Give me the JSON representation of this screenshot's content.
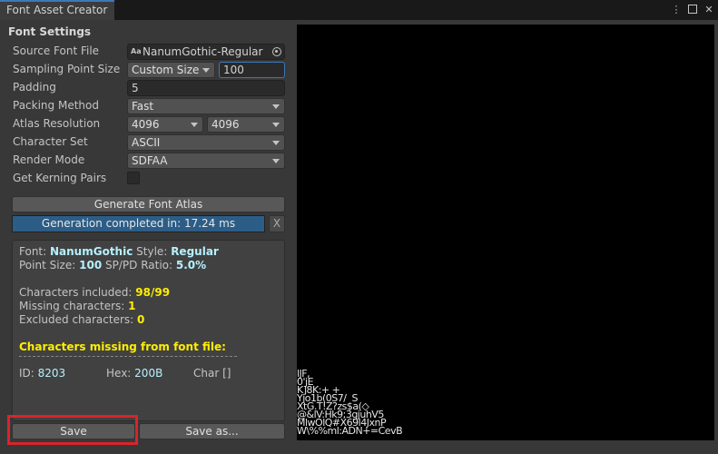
{
  "window": {
    "tab_title": "Font Asset Creator",
    "menu_icon": "kebab-menu-icon",
    "maximize_icon": "maximize-icon",
    "close_icon": "close-icon"
  },
  "settings": {
    "section_title": "Font Settings",
    "source_font_label": "Source Font File",
    "source_font_value": "NanumGothic-Regular",
    "source_font_icon": "font-asset-icon",
    "sampling_label": "Sampling Point Size",
    "sampling_mode": "Custom Size",
    "sampling_value": "100",
    "padding_label": "Padding",
    "padding_value": "5",
    "packing_label": "Packing Method",
    "packing_value": "Fast",
    "atlas_res_label": "Atlas Resolution",
    "atlas_width": "4096",
    "atlas_height": "4096",
    "charset_label": "Character Set",
    "charset_value": "ASCII",
    "render_mode_label": "Render Mode",
    "render_mode_value": "SDFAA",
    "kerning_label": "Get Kerning Pairs",
    "kerning_checked": false
  },
  "actions": {
    "generate_label": "Generate Font Atlas",
    "progress_text": "Generation completed in: 17.24 ms",
    "progress_fraction": 1.0,
    "clear_label": "X",
    "save_label": "Save",
    "save_as_label": "Save as..."
  },
  "report": {
    "font_label": "Font:",
    "font_value": "NanumGothic",
    "style_label": "Style:",
    "style_value": "Regular",
    "point_size_label": "Point Size:",
    "point_size_value": "100",
    "ratio_label": "SP/PD Ratio:",
    "ratio_value": "5.0%",
    "included_label": "Characters included:",
    "included_value": "98/99",
    "missing_label": "Missing characters:",
    "missing_value": "1",
    "excluded_label": "Excluded characters:",
    "excluded_value": "0",
    "missing_header": "Characters missing from font file:",
    "missing_id_label": "ID:",
    "missing_id_value": "8203",
    "missing_hex_label": "Hex:",
    "missing_hex_value": "200B",
    "missing_char_label": "Char []"
  },
  "atlas_glyph_rows": [
    "lJF,",
    "0'jE",
    "K]8K:+ +",
    "Yjo1b(0S7/  S",
    "XtG.T!Z?zs$a(◇",
    "@&lV:Hk9;3gjuhV5",
    "MlwOlQ#X69l4JxnP",
    "W\\%%ml:ADN+=CevB"
  ],
  "accent_colors": {
    "highlight_box": "#d9242a",
    "progress_fill": "#2c5d87",
    "value_cyan": "#b6f0ff",
    "value_yellow": "#ffee00"
  }
}
